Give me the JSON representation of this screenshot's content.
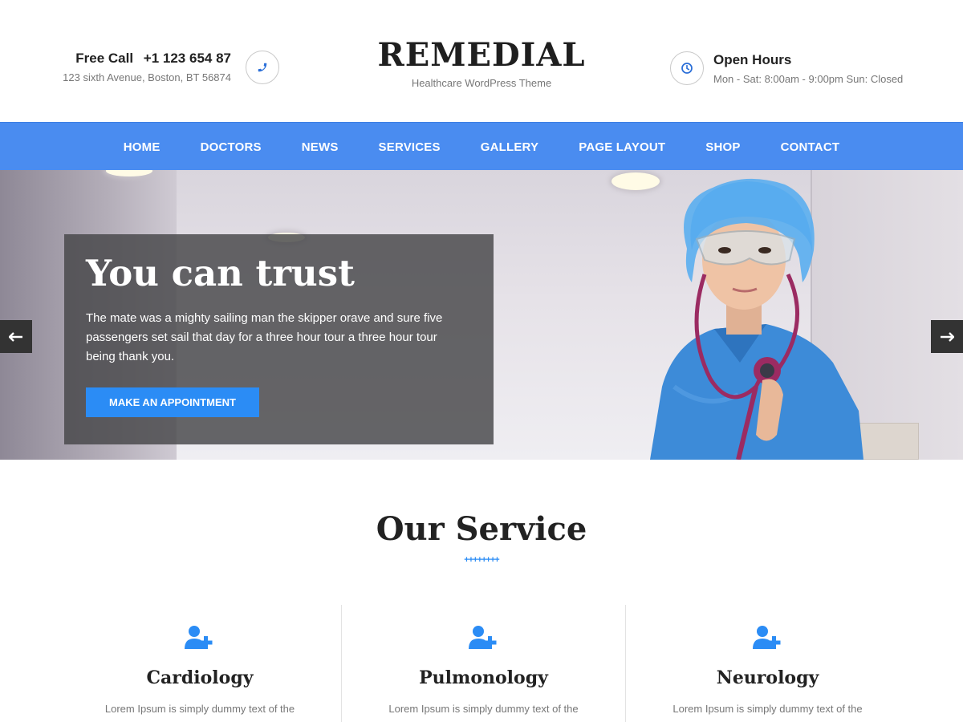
{
  "header": {
    "call_label": "Free Call",
    "phone": "+1 123 654 87",
    "address": "123 sixth Avenue, Boston, BT 56874",
    "logo": "REMEDIAL",
    "tagline": "Healthcare WordPress Theme",
    "hours_title": "Open Hours",
    "hours_text": "Mon - Sat: 8:00am - 9:00pm Sun: Closed",
    "phone_icon": "phone-icon",
    "clock_icon": "clock-icon"
  },
  "nav": {
    "items": [
      "HOME",
      "DOCTORS",
      "NEWS",
      "SERVICES",
      "GALLERY",
      "PAGE LAYOUT",
      "SHOP",
      "CONTACT"
    ]
  },
  "hero": {
    "title": "You can trust",
    "text": "The mate was a mighty sailing man the skipper orave and sure five passengers set sail that day for a three hour tour a three hour tour being thank you.",
    "button": "MAKE AN APPOINTMENT",
    "prev_icon": "arrow-left-icon",
    "next_icon": "arrow-right-icon"
  },
  "services": {
    "title": "Our Service",
    "divider": "++++++++",
    "items": [
      {
        "name": "Cardiology",
        "text": "Lorem Ipsum is simply dummy text of the",
        "icon": "user-plus-icon"
      },
      {
        "name": "Pulmonology",
        "text": "Lorem Ipsum is simply dummy text of the",
        "icon": "user-plus-icon"
      },
      {
        "name": "Neurology",
        "text": "Lorem Ipsum is simply dummy text of the",
        "icon": "user-plus-icon"
      }
    ]
  },
  "colors": {
    "accent": "#2b8cf5",
    "nav_bg": "#4a8cf0",
    "hero_box": "#464648"
  }
}
